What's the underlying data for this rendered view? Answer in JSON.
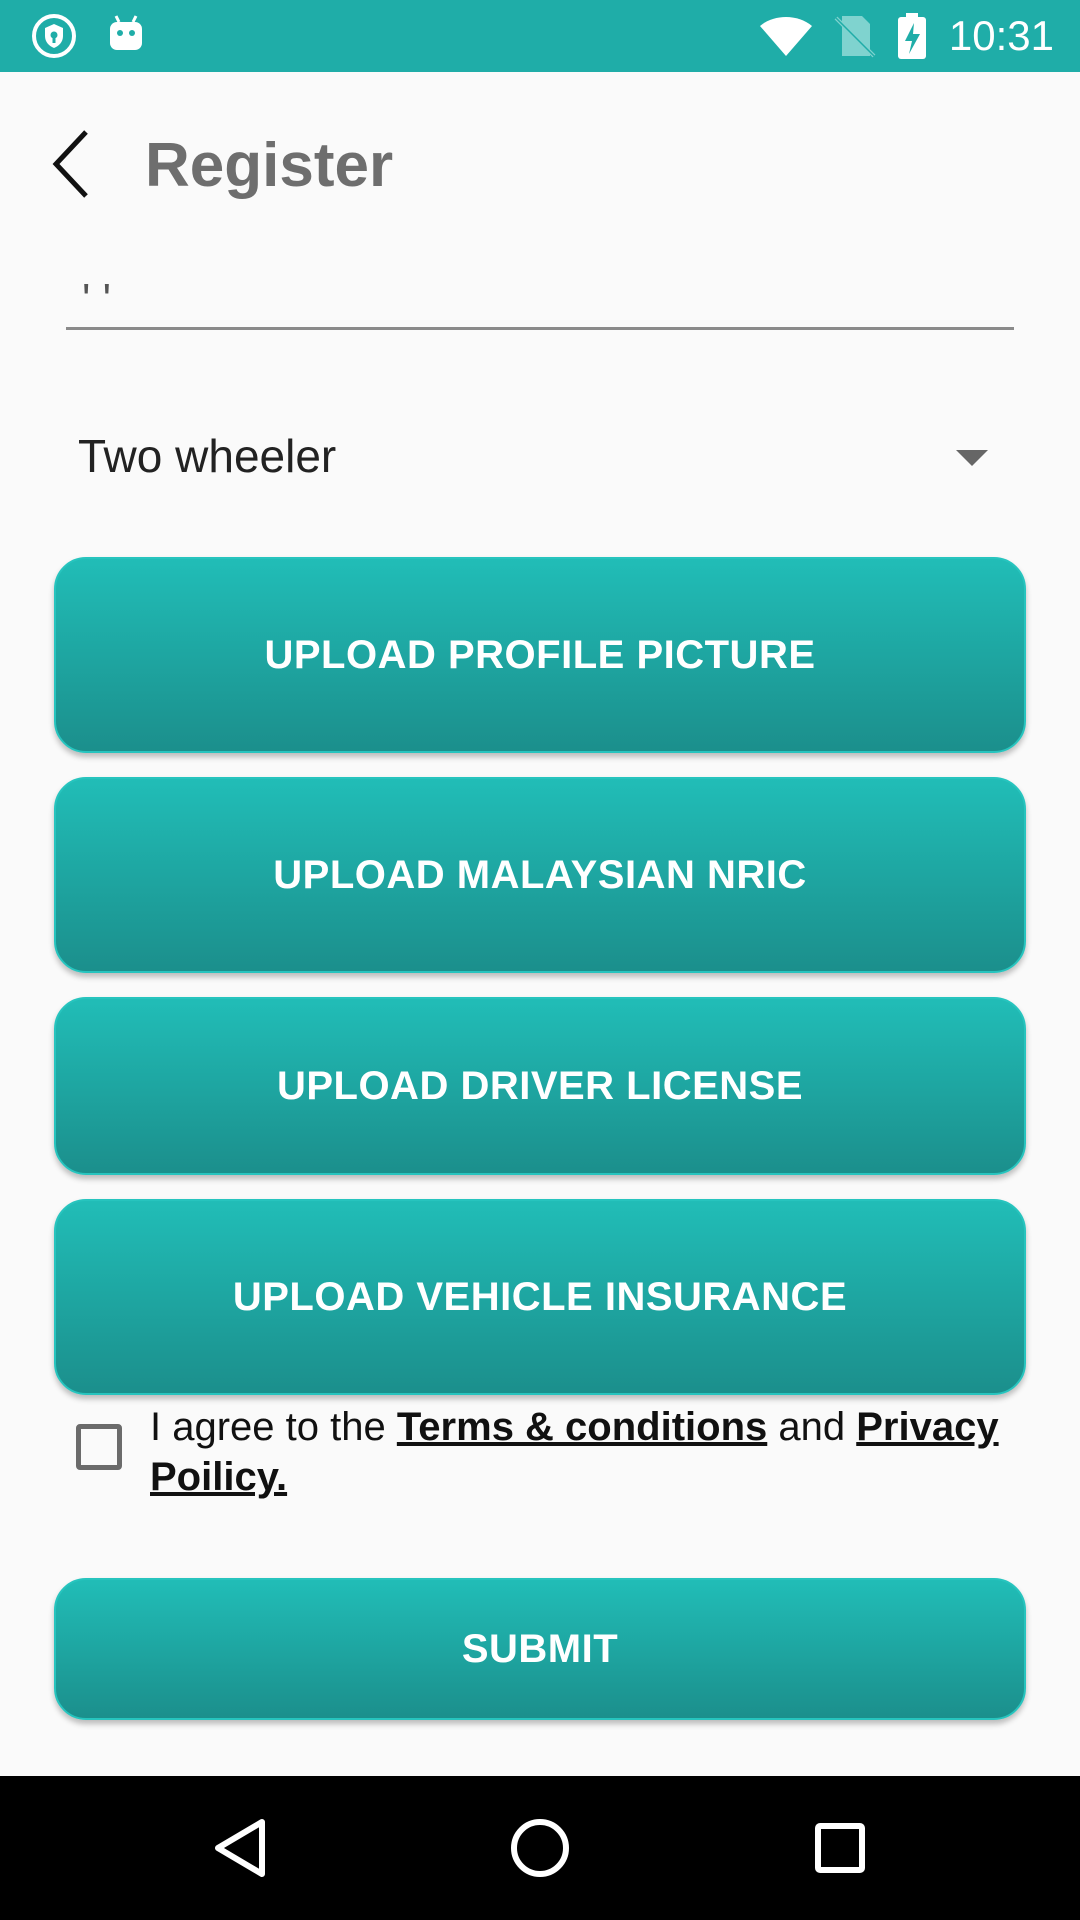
{
  "status_bar": {
    "time": "10:31",
    "icons": [
      "shield-notification-icon",
      "android-notification-icon",
      "wifi-icon",
      "no-sim-icon",
      "battery-charging-icon"
    ]
  },
  "toolbar": {
    "title": "Register",
    "back_icon": "chevron-left-icon"
  },
  "form": {
    "text_field_value": "' '",
    "vehicle_type": "Two wheeler",
    "buttons": {
      "profile_picture": "UPLOAD PROFILE PICTURE",
      "nric": "UPLOAD MALAYSIAN NRIC",
      "driver_license": "UPLOAD DRIVER LICENSE",
      "vehicle_insurance": "UPLOAD VEHICLE INSURANCE"
    },
    "terms": {
      "prefix": "I agree to the ",
      "terms_link": "Terms & conditions",
      "middle": " and ",
      "privacy_link": "Privacy Poilicy."
    },
    "submit_label": "SUBMIT"
  },
  "colors": {
    "accent": "#1fada8",
    "button_top": "#21bdb7",
    "button_bottom": "#1b8f8c"
  },
  "nav_bar": {
    "icons": [
      "back-triangle-icon",
      "home-circle-icon",
      "recents-square-icon"
    ]
  }
}
